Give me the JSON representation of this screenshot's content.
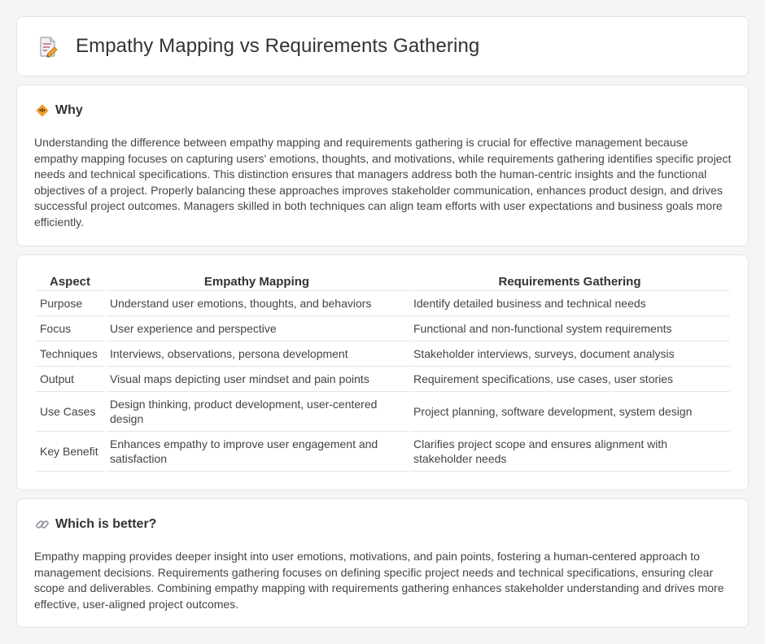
{
  "title": "Empathy Mapping vs Requirements Gathering",
  "why": {
    "heading": "Why",
    "body": "Understanding the difference between empathy mapping and requirements gathering is crucial for effective management because empathy mapping focuses on capturing users' emotions, thoughts, and motivations, while requirements gathering identifies specific project needs and technical specifications. This distinction ensures that managers address both the human-centric insights and the functional objectives of a project. Properly balancing these approaches improves stakeholder communication, enhances product design, and drives successful project outcomes. Managers skilled in both techniques can align team efforts with user expectations and business goals more efficiently."
  },
  "table": {
    "headers": [
      "Aspect",
      "Empathy Mapping",
      "Requirements Gathering"
    ],
    "rows": [
      [
        "Purpose",
        "Understand user emotions, thoughts, and behaviors",
        "Identify detailed business and technical needs"
      ],
      [
        "Focus",
        "User experience and perspective",
        "Functional and non-functional system requirements"
      ],
      [
        "Techniques",
        "Interviews, observations, persona development",
        "Stakeholder interviews, surveys, document analysis"
      ],
      [
        "Output",
        "Visual maps depicting user mindset and pain points",
        "Requirement specifications, use cases, user stories"
      ],
      [
        "Use Cases",
        "Design thinking, product development, user-centered design",
        "Project planning, software development, system design"
      ],
      [
        "Key Benefit",
        "Enhances empathy to improve user engagement and satisfaction",
        "Clarifies project scope and ensures alignment with stakeholder needs"
      ]
    ]
  },
  "better": {
    "heading": "Which is better?",
    "body": "Empathy mapping provides deeper insight into user emotions, motivations, and pain points, fostering a human-centered approach to management decisions. Requirements gathering focuses on defining specific project needs and technical specifications, ensuring clear scope and deliverables. Combining empathy mapping with requirements gathering enhances stakeholder understanding and drives more effective, user-aligned project outcomes."
  },
  "colors": {
    "page_bg": "#f4f5f7",
    "card_border": "#e1e4e8",
    "icon_orange": "#f0a030",
    "link_icon": "#8a8f98"
  },
  "icons": {
    "title": "document-pencil-icon",
    "why": "diamond-warning-icon",
    "better": "link-icon"
  }
}
